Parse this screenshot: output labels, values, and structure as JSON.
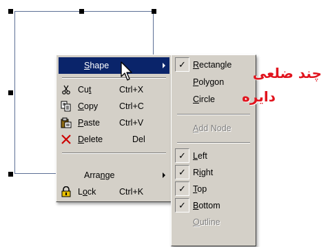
{
  "main_menu": {
    "items": [
      {
        "label_pre": "",
        "label_u": "S",
        "label_post": "hape",
        "shortcut": "",
        "icon": "",
        "submenu": true
      },
      {
        "label_pre": "Cu",
        "label_u": "t",
        "label_post": "",
        "shortcut": "Ctrl+X",
        "icon": "scissors-icon"
      },
      {
        "label_pre": "",
        "label_u": "C",
        "label_post": "opy",
        "shortcut": "Ctrl+C",
        "icon": "copy-icon"
      },
      {
        "label_pre": "",
        "label_u": "P",
        "label_post": "aste",
        "shortcut": "Ctrl+V",
        "icon": "paste-icon"
      },
      {
        "label_pre": "",
        "label_u": "D",
        "label_post": "elete",
        "shortcut": "Del",
        "icon": "delete-icon"
      },
      {
        "label_pre": "Arra",
        "label_u": "n",
        "label_post": "ge",
        "shortcut": "",
        "icon": "",
        "submenu": true
      },
      {
        "label_pre": "L",
        "label_u": "o",
        "label_post": "ck",
        "shortcut": "Ctrl+K",
        "icon": "lock-icon"
      }
    ]
  },
  "sub_menu": {
    "items": [
      {
        "label_pre": "",
        "label_u": "R",
        "label_post": "ectangle",
        "checked": true,
        "disabled": false
      },
      {
        "label_pre": "",
        "label_u": "P",
        "label_post": "olygon",
        "checked": false,
        "disabled": false
      },
      {
        "label_pre": "",
        "label_u": "C",
        "label_post": "ircle",
        "checked": false,
        "disabled": false
      },
      {
        "label_pre": "",
        "label_u": "A",
        "label_post": "dd Node",
        "checked": false,
        "disabled": true
      },
      {
        "label_pre": "",
        "label_u": "L",
        "label_post": "eft",
        "checked": true,
        "disabled": false
      },
      {
        "label_pre": "R",
        "label_u": "i",
        "label_post": "ght",
        "checked": true,
        "disabled": false
      },
      {
        "label_pre": "",
        "label_u": "T",
        "label_post": "op",
        "checked": true,
        "disabled": false
      },
      {
        "label_pre": "",
        "label_u": "B",
        "label_post": "ottom",
        "checked": true,
        "disabled": false
      },
      {
        "label_pre": "",
        "label_u": "O",
        "label_post": "utline",
        "checked": false,
        "disabled": true
      }
    ]
  },
  "check_glyph": "✓",
  "annotations": {
    "line1": "چند ضلعی",
    "line2": "دایره"
  },
  "colors": {
    "menu_bg": "#d4d0c8",
    "highlight": "#0a246a",
    "annotation": "#e1141e"
  }
}
